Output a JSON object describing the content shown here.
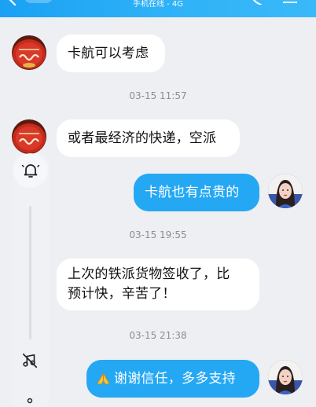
{
  "status_bar": {
    "network_status": "手机在线 - 4G"
  },
  "messages": [
    {
      "text": "卡航可以考虑"
    },
    {
      "time": "03-15 11:57"
    },
    {
      "text": "或者最经济的快递，空派"
    },
    {
      "text": "卡航也有点贵的"
    },
    {
      "time": "03-15 19:55"
    },
    {
      "text_line1": "上次的铁派货物签收了，比",
      "text_line2": "预计快，辛苦了！"
    },
    {
      "time": "03-15 21:38"
    },
    {
      "text": "谢谢信任，多多支持"
    }
  ],
  "colors": {
    "header_accent": "#1aa1f4",
    "outgoing_bubble": "#24a8f4",
    "incoming_bubble": "#ffffff",
    "background": "#eeeff3"
  },
  "icons": {
    "header": [
      "back-icon",
      "call-icon",
      "menu-icon"
    ],
    "floating_panel": [
      "bell-icon",
      "music-off-icon",
      "more-icon"
    ],
    "emoji": "pray-hands-emoji"
  }
}
